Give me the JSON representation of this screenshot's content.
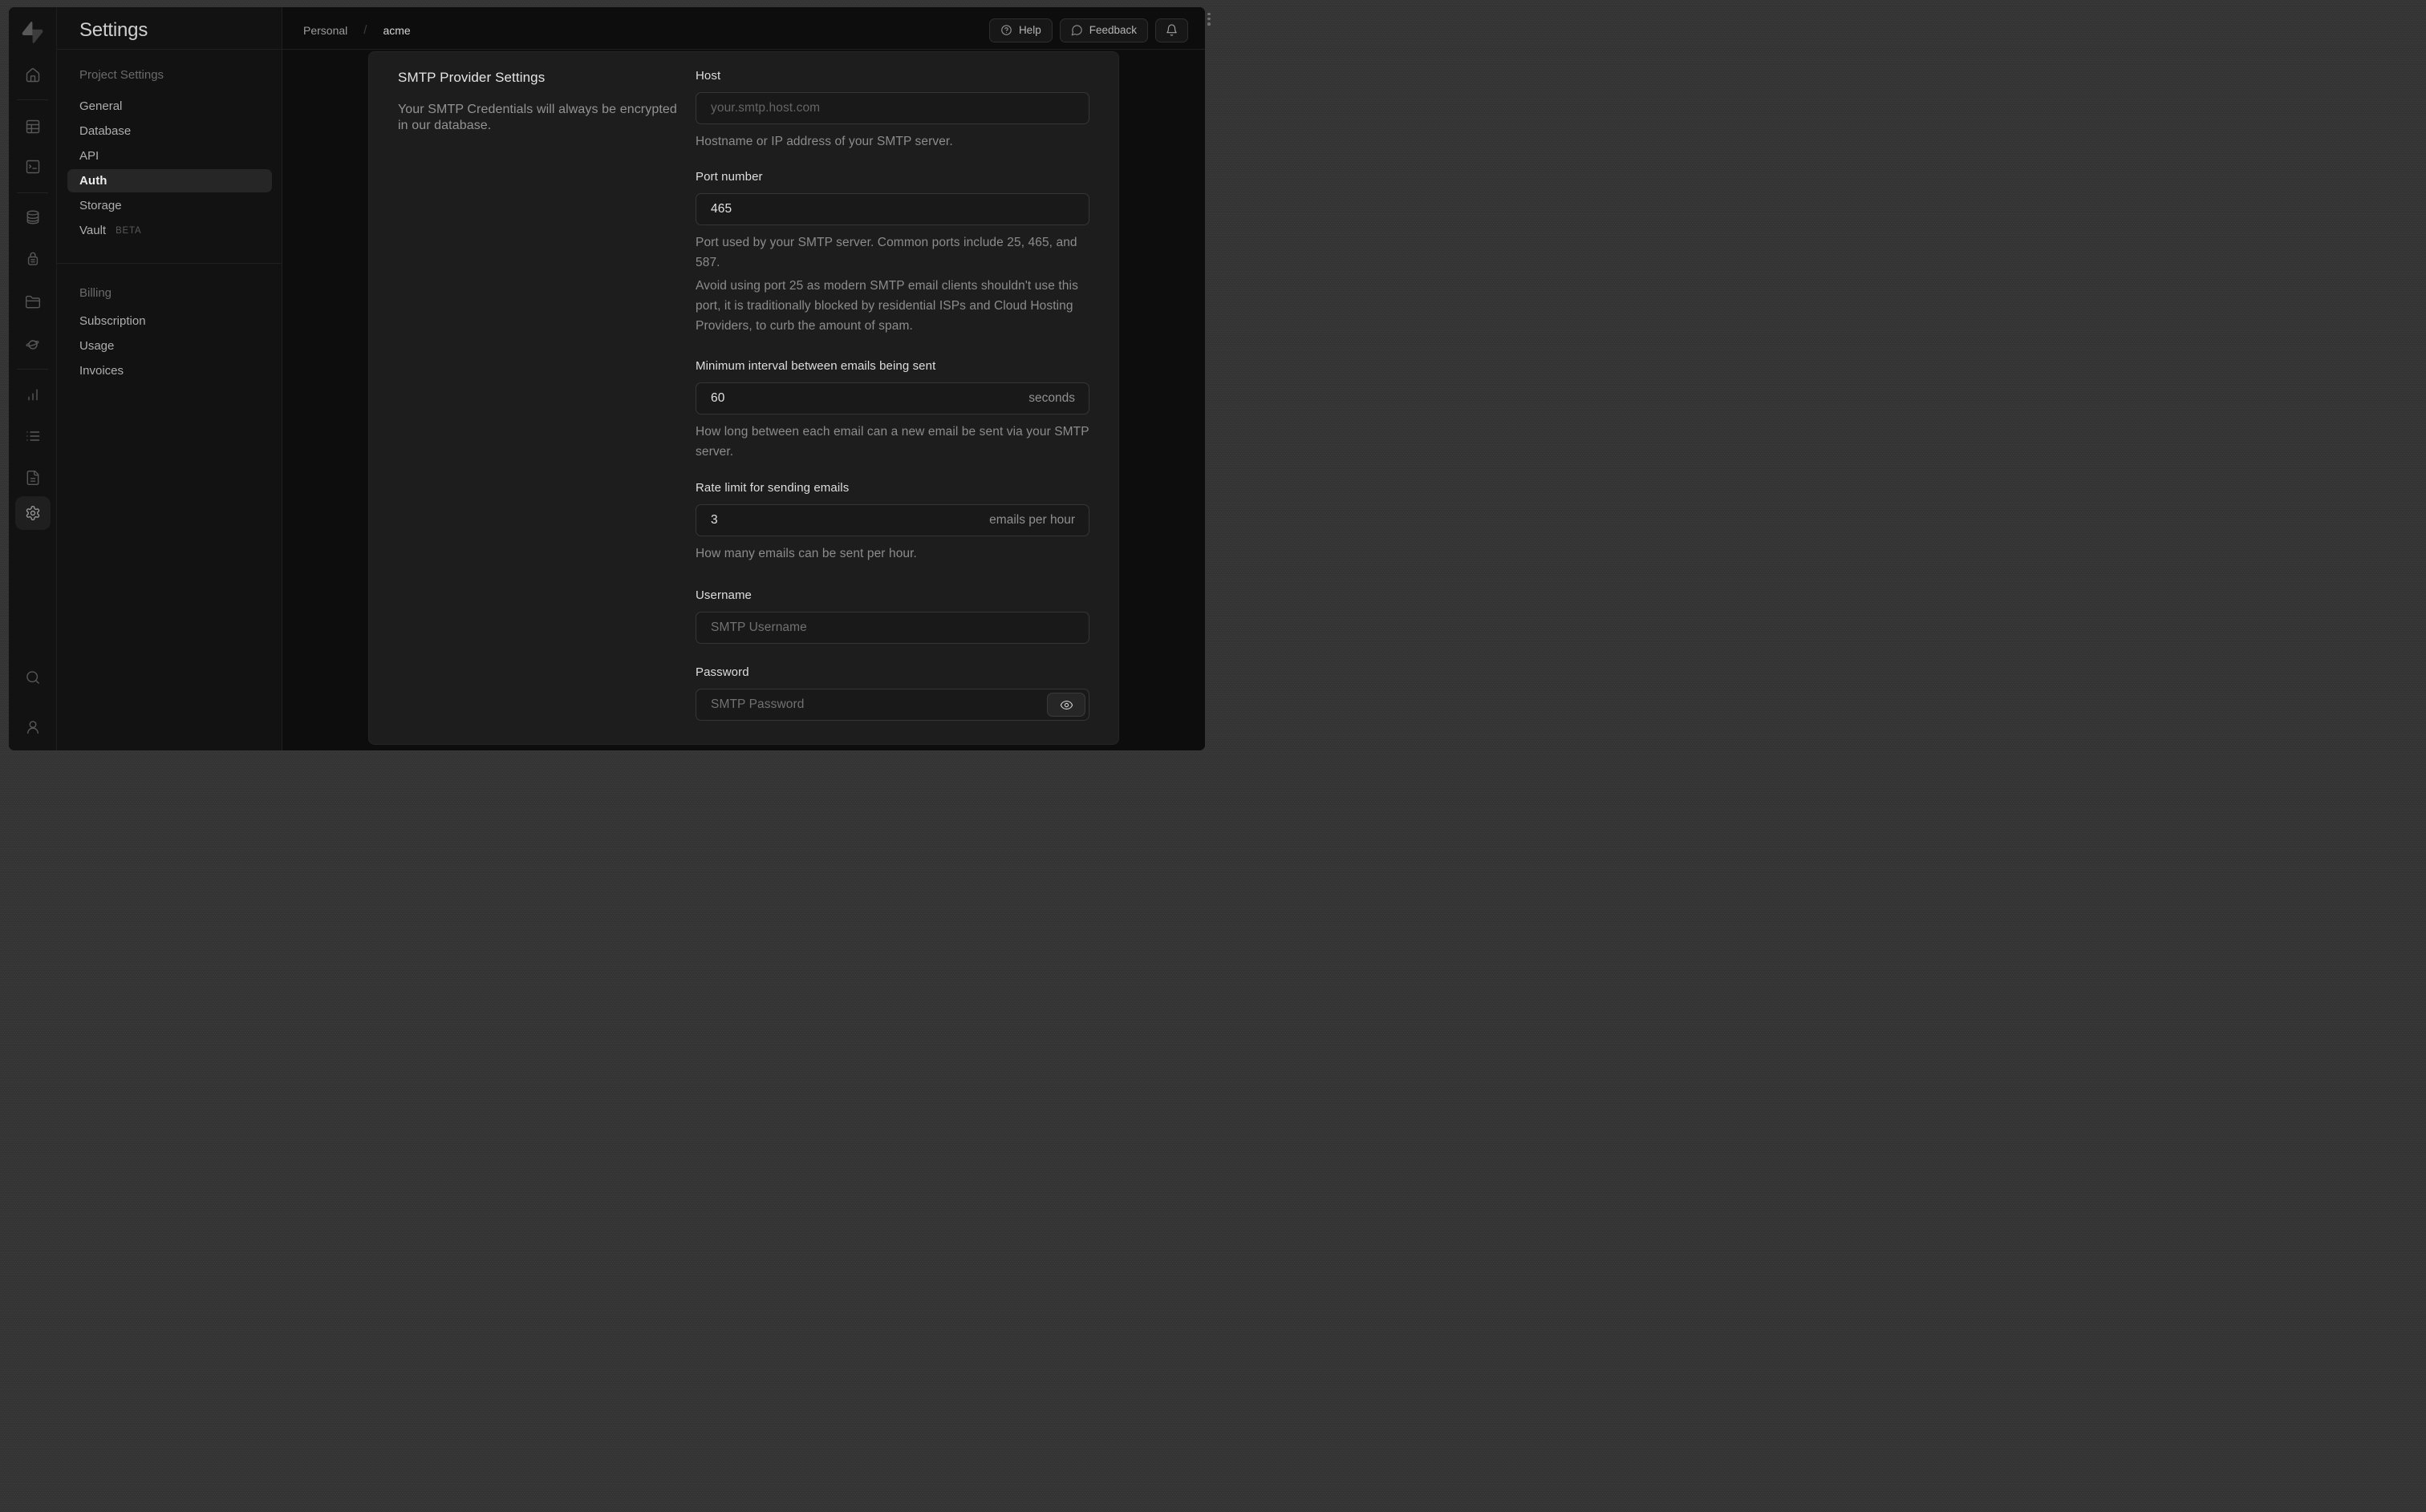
{
  "header": {
    "title": "Settings",
    "breadcrumb": {
      "org": "Personal",
      "separator": "/",
      "project": "acme"
    },
    "actions": {
      "help": "Help",
      "feedback": "Feedback"
    }
  },
  "icons": {
    "logo": "supabase-bolt",
    "rail": [
      "home",
      "table",
      "terminal",
      "database",
      "lock",
      "folder",
      "planet",
      "bar-chart",
      "list",
      "file-text",
      "gear",
      "search",
      "user"
    ],
    "help_button": "circled-question-mark",
    "feedback_button": "speech-bubble",
    "notifications_button": "bell",
    "password_reveal": "eye"
  },
  "sidebar": {
    "sections": [
      {
        "heading": "Project Settings",
        "items": [
          {
            "label": "General"
          },
          {
            "label": "Database"
          },
          {
            "label": "API"
          },
          {
            "label": "Auth",
            "active": true
          },
          {
            "label": "Storage"
          },
          {
            "label": "Vault",
            "badge": "BETA"
          }
        ]
      },
      {
        "heading": "Billing",
        "items": [
          {
            "label": "Subscription"
          },
          {
            "label": "Usage"
          },
          {
            "label": "Invoices"
          }
        ]
      }
    ]
  },
  "content": {
    "section_title": "SMTP Provider Settings",
    "section_description": "Your SMTP Credentials will always be encrypted in our database.",
    "fields": {
      "host": {
        "label": "Host",
        "placeholder": "your.smtp.host.com",
        "helper": "Hostname or IP address of your SMTP server."
      },
      "port": {
        "label": "Port number",
        "value": "465",
        "helper1": "Port used by your SMTP server. Common ports include 25, 465, and 587.",
        "helper2": "Avoid using port 25 as modern SMTP email clients shouldn't use this port, it is traditionally blocked by residential ISPs and Cloud Hosting Providers, to curb the amount of spam."
      },
      "interval": {
        "label": "Minimum interval between emails being sent",
        "value": "60",
        "suffix": "seconds",
        "helper": "How long between each email can a new email be sent via your SMTP server."
      },
      "rate": {
        "label": "Rate limit for sending emails",
        "value": "3",
        "suffix": "emails per hour",
        "helper": "How many emails can be sent per hour."
      },
      "username": {
        "label": "Username",
        "placeholder": "SMTP Username"
      },
      "password": {
        "label": "Password",
        "placeholder": "SMTP Password"
      }
    }
  }
}
